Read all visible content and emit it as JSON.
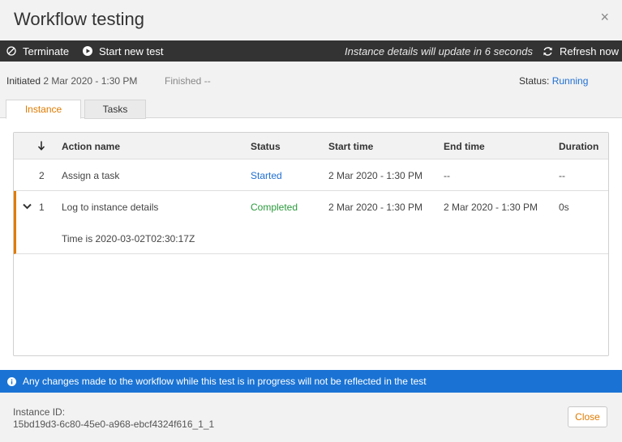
{
  "dialog": {
    "title": "Workflow testing",
    "close_icon": "×"
  },
  "toolbar": {
    "terminate_label": "Terminate",
    "start_new_test_label": "Start new test",
    "update_note": "Instance details will update in 6 seconds",
    "refresh_label": "Refresh now"
  },
  "info": {
    "initiated_label": "Initiated",
    "initiated_value": "2 Mar 2020 - 1:30 PM",
    "finished_label": "Finished",
    "finished_value": "--",
    "status_label": "Status:",
    "status_value": "Running"
  },
  "tabs": [
    {
      "label": "Instance",
      "active": true
    },
    {
      "label": "Tasks",
      "active": false
    }
  ],
  "table": {
    "sort_icon": "arrow-down-icon",
    "columns": [
      "Action name",
      "Status",
      "Start time",
      "End time",
      "Duration"
    ],
    "rows": [
      {
        "index": "2",
        "action": "Assign a task",
        "status": "Started",
        "start": "2 Mar 2020 - 1:30 PM",
        "end": "--",
        "duration": "--",
        "detail": ""
      },
      {
        "index": "1",
        "action": "Log to instance details",
        "status": "Completed",
        "start": "2 Mar 2020 - 1:30 PM",
        "end": "2 Mar 2020 - 1:30 PM",
        "duration": "0s",
        "detail": "Time is 2020-03-02T02:30:17Z",
        "expanded": true
      }
    ]
  },
  "banner": {
    "message": "Any changes made to the workflow while this test is in progress will not be reflected in the test"
  },
  "footer": {
    "instance_id_label": "Instance ID:",
    "instance_id_value": "15bd19d3-6c80-45e0-a968-ebcf4324f616_1_1",
    "close_label": "Close"
  },
  "colors": {
    "accent": "#e07b00",
    "link": "#1f6fd1",
    "success": "#2a9a3c",
    "banner": "#1a73d4",
    "toolbar": "#333333"
  }
}
